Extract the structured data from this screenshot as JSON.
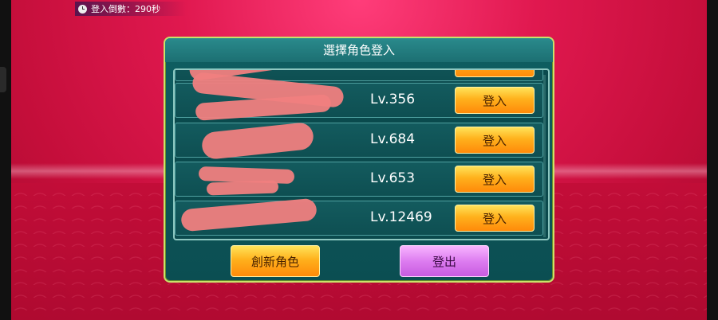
{
  "timer": {
    "text": "登入倒數：290秒"
  },
  "dialog": {
    "title": "選擇角色登入",
    "rows": [
      {
        "name": "",
        "level": "Lv.356",
        "button": "登入"
      },
      {
        "name": "",
        "level": "Lv.684",
        "button": "登入"
      },
      {
        "name": "",
        "level": "Lv.653",
        "button": "登入"
      },
      {
        "name": "",
        "level": "Lv.12469",
        "button": "登入"
      }
    ],
    "create_button": "創新角色",
    "logout_button": "登出"
  },
  "colors": {
    "background": "#e0184f",
    "dialog_bg": "#0f5f62",
    "orange_button": "#ffb11c",
    "purple_button": "#dd7df0",
    "redaction": "#f08080"
  },
  "icons": [
    "clock-icon"
  ]
}
